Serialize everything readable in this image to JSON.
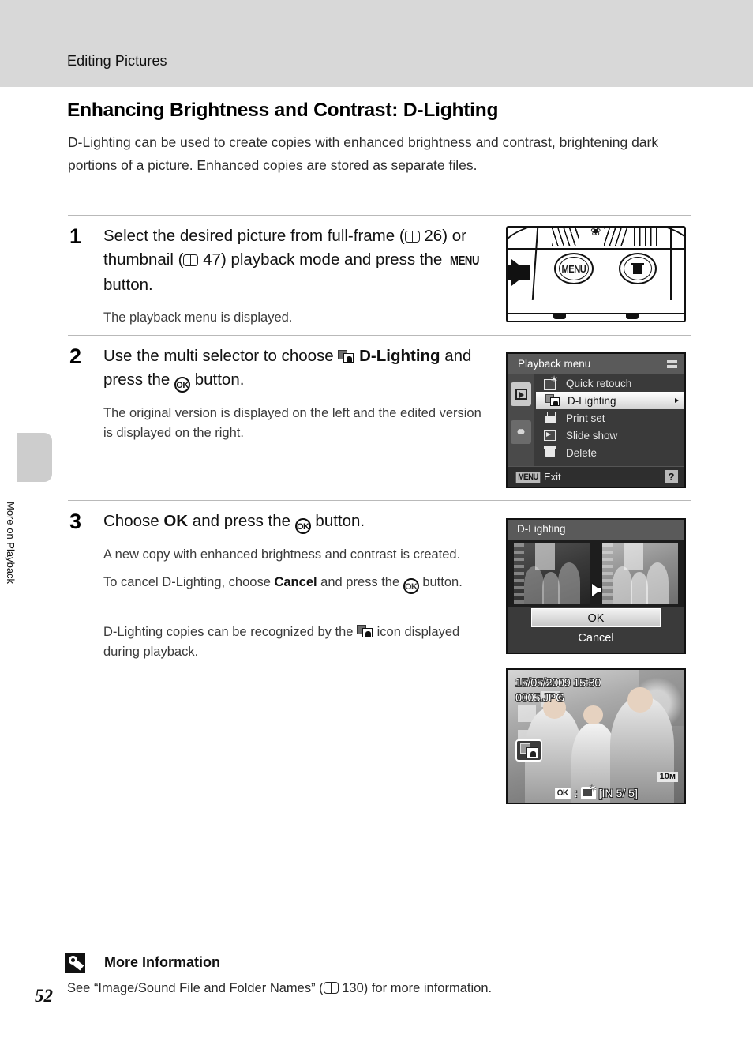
{
  "header": {
    "chapter": "Editing Pictures"
  },
  "side_tab": {
    "label": "More on Playback"
  },
  "section": {
    "heading": "Enhancing Brightness and Contrast: D-Lighting",
    "intro": "D-Lighting can be used to create copies with enhanced brightness and contrast, brightening dark portions of a picture. Enhanced copies are stored as separate files."
  },
  "steps": [
    {
      "number": "1",
      "title_a": "Select the desired picture from full-frame (",
      "ref1": "26",
      "title_b": ") or thumbnail (",
      "ref2": "47",
      "title_c": ") playback mode and press the ",
      "menu_key": "MENU",
      "title_d": " button.",
      "desc": "The playback menu is displayed."
    },
    {
      "number": "2",
      "title_a": "Use the multi selector to choose ",
      "bold_item": "D-Lighting",
      "title_b": " and press the ",
      "ok_key": "OK",
      "title_c": " button.",
      "desc": "The original version is displayed on the left and the edited version is displayed on the right."
    },
    {
      "number": "3",
      "title_a": "Choose ",
      "bold_ok": "OK",
      "title_b": " and press the ",
      "ok_key": "OK",
      "title_c": " button.",
      "desc1": "A new copy with enhanced brightness and contrast is created.",
      "desc2_a": "To cancel D-Lighting, choose ",
      "desc2_bold": "Cancel",
      "desc2_b": " and press the ",
      "desc2_c": " button.",
      "desc3_a": "D-Lighting copies can be recognized by the ",
      "desc3_b": " icon displayed during playback."
    }
  ],
  "camera_figure": {
    "menu_button_label": "MENU",
    "trash_icon": "trash-icon",
    "macro_icon": "macro-flower-icon",
    "arrow_icon": "pointer-arrow-icon"
  },
  "playback_menu_screen": {
    "title": "Playback menu",
    "items": [
      {
        "label": "Quick retouch",
        "icon": "quick-retouch-icon",
        "selected": false
      },
      {
        "label": "D-Lighting",
        "icon": "d-lighting-icon",
        "selected": true
      },
      {
        "label": "Print set",
        "icon": "print-set-icon",
        "selected": false
      },
      {
        "label": "Slide show",
        "icon": "slide-show-icon",
        "selected": false
      },
      {
        "label": "Delete",
        "icon": "delete-trash-icon",
        "selected": false
      }
    ],
    "tabs": [
      {
        "icon": "playback-tab-icon",
        "selected": true
      },
      {
        "icon": "setup-wrench-tab-icon",
        "selected": false
      }
    ],
    "footer": {
      "key": "MENU",
      "label": "Exit",
      "help": "?"
    }
  },
  "dlighting_screen": {
    "title": "D-Lighting",
    "buttons": [
      {
        "label": "OK",
        "selected": true
      },
      {
        "label": "Cancel",
        "selected": false
      }
    ]
  },
  "playback_screen": {
    "date": "15/05/2009 15:30",
    "filename": "0005.JPG",
    "dlighting_badge": "d-lighting-copy-icon",
    "image_size": "10м",
    "ok_key": "OK",
    "retouch_icon": "quick-retouch-icon",
    "memory": "IN",
    "frame_current": "5/",
    "frame_total": "5"
  },
  "more_information": {
    "title": "More Information",
    "text_a": "See “Image/Sound File and Folder Names” (",
    "page_ref": "130",
    "text_b": ") for more information."
  },
  "page_number": "52",
  "colors": {
    "header_band": "#d8d8d8",
    "lcd_dark": "#3a3a3a",
    "lcd_title": "#5a5a5a",
    "selection_highlight": "#ffffff"
  }
}
